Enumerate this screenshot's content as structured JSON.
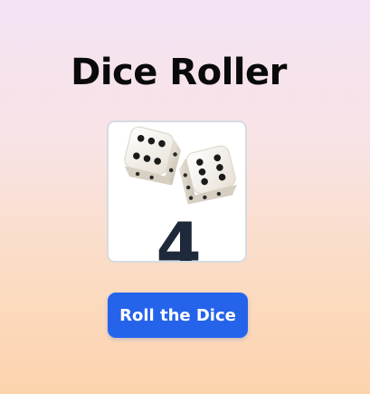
{
  "app": {
    "title": "Dice Roller"
  },
  "display": {
    "image_icon": "two-dice-image",
    "result_value": "4"
  },
  "actions": {
    "roll_label": "Roll the Dice"
  },
  "colors": {
    "button_bg": "#2563eb",
    "result_text": "#1e293b",
    "title_text": "#0a0a0a"
  }
}
